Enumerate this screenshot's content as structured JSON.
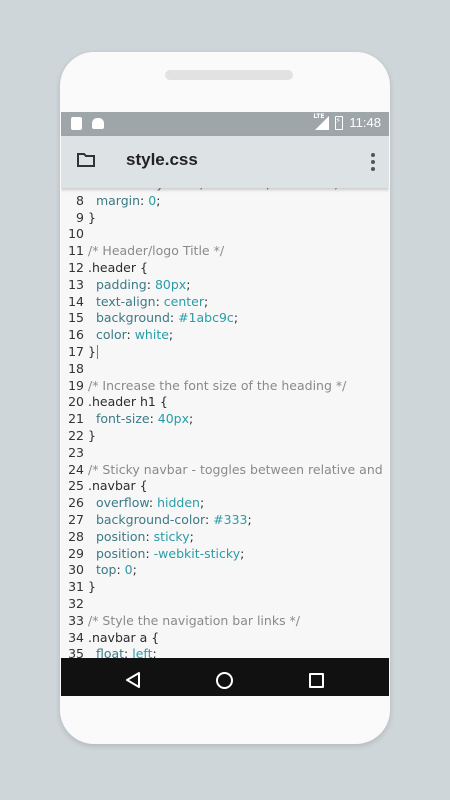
{
  "statusbar": {
    "time": "11:48",
    "network": "LTE"
  },
  "appbar": {
    "title": "style.css"
  },
  "editor": {
    "lines": [
      {
        "n": "",
        "tokens": [
          [
            "  font-family: Arial, Helvetica, sans-serif;",
            "pr"
          ]
        ]
      },
      {
        "n": "8",
        "tokens": [
          [
            "  margin",
            "pr"
          ],
          [
            ": ",
            "src"
          ],
          [
            "0",
            "vl"
          ],
          [
            ";",
            "src"
          ]
        ]
      },
      {
        "n": "9",
        "tokens": [
          [
            "}",
            "src"
          ]
        ]
      },
      {
        "n": "10",
        "tokens": []
      },
      {
        "n": "11",
        "tokens": [
          [
            "/* Header/logo Title */",
            "cm"
          ]
        ]
      },
      {
        "n": "12",
        "tokens": [
          [
            ".header {",
            "src"
          ]
        ]
      },
      {
        "n": "13",
        "tokens": [
          [
            "  padding",
            "pr"
          ],
          [
            ": ",
            "src"
          ],
          [
            "80px",
            "vl"
          ],
          [
            ";",
            "src"
          ]
        ]
      },
      {
        "n": "14",
        "tokens": [
          [
            "  text-align",
            "pr"
          ],
          [
            ": ",
            "src"
          ],
          [
            "center",
            "vl"
          ],
          [
            ";",
            "src"
          ]
        ]
      },
      {
        "n": "15",
        "tokens": [
          [
            "  background",
            "pr"
          ],
          [
            ": ",
            "src"
          ],
          [
            "#1abc9c",
            "vl"
          ],
          [
            ";",
            "src"
          ]
        ]
      },
      {
        "n": "16",
        "tokens": [
          [
            "  color",
            "pr"
          ],
          [
            ": ",
            "src"
          ],
          [
            "white",
            "vl"
          ],
          [
            ";",
            "src"
          ]
        ]
      },
      {
        "n": "17",
        "tokens": [
          [
            "}",
            "src"
          ]
        ],
        "cursor": true
      },
      {
        "n": "18",
        "tokens": []
      },
      {
        "n": "19",
        "tokens": [
          [
            "/* Increase the font size of the heading */",
            "cm"
          ]
        ]
      },
      {
        "n": "20",
        "tokens": [
          [
            ".header h1 {",
            "src"
          ]
        ]
      },
      {
        "n": "21",
        "tokens": [
          [
            "  font-size",
            "pr"
          ],
          [
            ": ",
            "src"
          ],
          [
            "40px",
            "vl"
          ],
          [
            ";",
            "src"
          ]
        ]
      },
      {
        "n": "22",
        "tokens": [
          [
            "}",
            "src"
          ]
        ]
      },
      {
        "n": "23",
        "tokens": []
      },
      {
        "n": "24",
        "tokens": [
          [
            "/* Sticky navbar - toggles between relative and",
            "cm"
          ]
        ]
      },
      {
        "n": "25",
        "tokens": [
          [
            ".navbar {",
            "src"
          ]
        ]
      },
      {
        "n": "26",
        "tokens": [
          [
            "  overflow",
            "pr"
          ],
          [
            ": ",
            "src"
          ],
          [
            "hidden",
            "vl"
          ],
          [
            ";",
            "src"
          ]
        ]
      },
      {
        "n": "27",
        "tokens": [
          [
            "  background-color",
            "pr"
          ],
          [
            ": ",
            "src"
          ],
          [
            "#333",
            "vl"
          ],
          [
            ";",
            "src"
          ]
        ]
      },
      {
        "n": "28",
        "tokens": [
          [
            "  position",
            "pr"
          ],
          [
            ": ",
            "src"
          ],
          [
            "sticky",
            "vl"
          ],
          [
            ";",
            "src"
          ]
        ]
      },
      {
        "n": "29",
        "tokens": [
          [
            "  position",
            "pr"
          ],
          [
            ": ",
            "src"
          ],
          [
            "-webkit-sticky",
            "vl"
          ],
          [
            ";",
            "src"
          ]
        ]
      },
      {
        "n": "30",
        "tokens": [
          [
            "  top",
            "pr"
          ],
          [
            ": ",
            "src"
          ],
          [
            "0",
            "vl"
          ],
          [
            ";",
            "src"
          ]
        ]
      },
      {
        "n": "31",
        "tokens": [
          [
            "}",
            "src"
          ]
        ]
      },
      {
        "n": "32",
        "tokens": []
      },
      {
        "n": "33",
        "tokens": [
          [
            "/* Style the navigation bar links */",
            "cm"
          ]
        ]
      },
      {
        "n": "34",
        "tokens": [
          [
            ".navbar a {",
            "src"
          ]
        ]
      },
      {
        "n": "35",
        "tokens": [
          [
            "  float",
            "pr"
          ],
          [
            ": ",
            "src"
          ],
          [
            "left",
            "vl"
          ],
          [
            ";",
            "src"
          ]
        ]
      }
    ]
  },
  "icons": {
    "folder": "folder-icon",
    "more": "more-vert-icon",
    "back": "back-icon",
    "home": "home-icon",
    "recents": "recents-icon"
  },
  "colors": {
    "comment": "#8a8a8a",
    "property": "#3b7a86",
    "value": "#2a9ca6",
    "appbar": "#dde2e5",
    "statusbar": "#9ea6aa"
  }
}
